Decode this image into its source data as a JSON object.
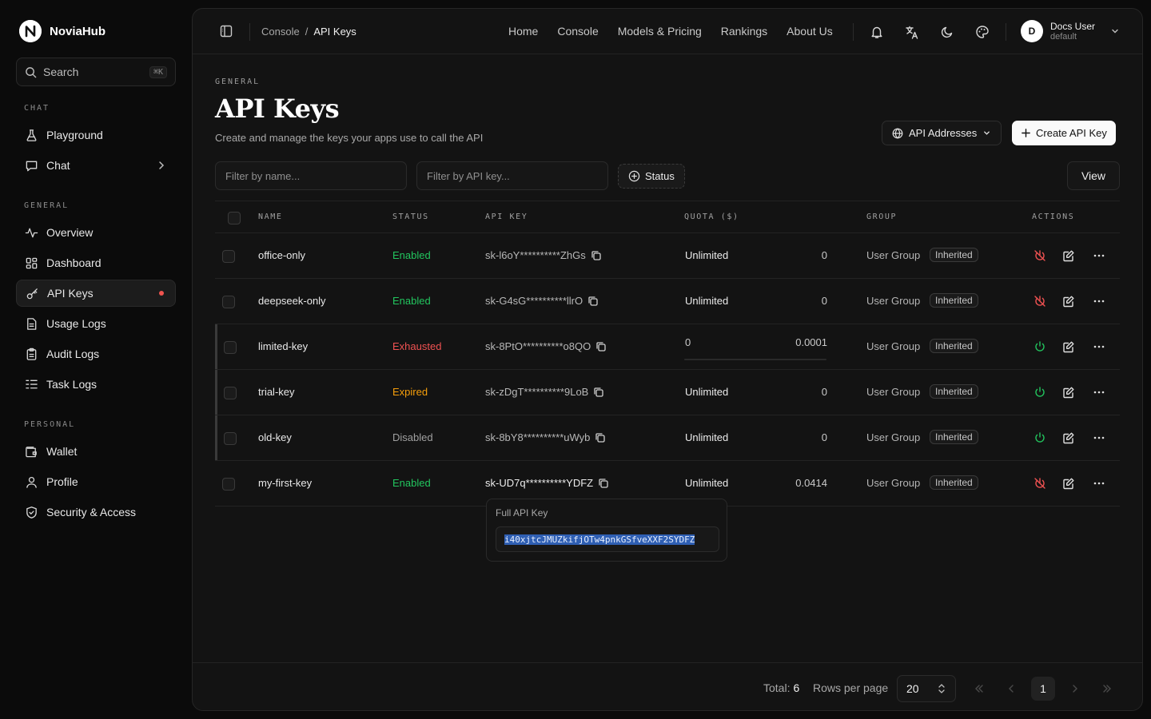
{
  "brand": {
    "name": "NoviaHub"
  },
  "search": {
    "placeholder": "Search",
    "shortcut": "⌘K"
  },
  "sidebar": {
    "sections": [
      {
        "label": "CHAT"
      },
      {
        "label": "GENERAL"
      },
      {
        "label": "PERSONAL"
      }
    ],
    "items": [
      {
        "label": "Playground",
        "icon": "flask-icon"
      },
      {
        "label": "Chat",
        "icon": "message-icon"
      },
      {
        "label": "Overview",
        "icon": "activity-icon"
      },
      {
        "label": "Dashboard",
        "icon": "grid-icon"
      },
      {
        "label": "API Keys",
        "icon": "key-icon",
        "active": true
      },
      {
        "label": "Usage Logs",
        "icon": "file-icon"
      },
      {
        "label": "Audit Logs",
        "icon": "clipboard-icon"
      },
      {
        "label": "Task Logs",
        "icon": "list-icon"
      },
      {
        "label": "Wallet",
        "icon": "wallet-icon"
      },
      {
        "label": "Profile",
        "icon": "user-icon"
      },
      {
        "label": "Security & Access",
        "icon": "shield-icon"
      }
    ]
  },
  "breadcrumb": {
    "parent": "Console",
    "sep": "/",
    "current": "API Keys"
  },
  "topnav": [
    "Home",
    "Console",
    "Models & Pricing",
    "Rankings",
    "About Us"
  ],
  "user": {
    "initial": "D",
    "name": "Docs User",
    "group": "default"
  },
  "page": {
    "eyebrow": "GENERAL",
    "title": "API Keys",
    "subtitle": "Create and manage the keys your apps use to call the API",
    "api_addresses_label": "API Addresses",
    "create_label": "Create API Key"
  },
  "filters": {
    "name_placeholder": "Filter by name...",
    "key_placeholder": "Filter by API key...",
    "status_label": "Status",
    "view_label": "View"
  },
  "table": {
    "headers": [
      "NAME",
      "STATUS",
      "API KEY",
      "QUOTA ($)",
      "GROUP",
      "ACTIONS"
    ],
    "rows": [
      {
        "name": "office-only",
        "status": "Enabled",
        "key": "sk-l6oY**********ZhGs",
        "quota": "Unlimited",
        "used": "0",
        "group": "User Group",
        "badge": "Inherited"
      },
      {
        "name": "deepseek-only",
        "status": "Enabled",
        "key": "sk-G4sG**********llrO",
        "quota": "Unlimited",
        "used": "0",
        "group": "User Group",
        "badge": "Inherited"
      },
      {
        "name": "limited-key",
        "status": "Exhausted",
        "key": "sk-8PtO**********o8QO",
        "quota": "0",
        "used": "0.0001",
        "group": "User Group",
        "badge": "Inherited"
      },
      {
        "name": "trial-key",
        "status": "Expired",
        "key": "sk-zDgT**********9LoB",
        "quota": "Unlimited",
        "used": "0",
        "group": "User Group",
        "badge": "Inherited"
      },
      {
        "name": "old-key",
        "status": "Disabled",
        "key": "sk-8bY8**********uWyb",
        "quota": "Unlimited",
        "used": "0",
        "group": "User Group",
        "badge": "Inherited"
      },
      {
        "name": "my-first-key",
        "status": "Enabled",
        "key": "sk-UD7q**********YDFZ",
        "quota": "Unlimited",
        "used": "0.0414",
        "group": "User Group",
        "badge": "Inherited"
      }
    ]
  },
  "popover": {
    "label": "Full API Key",
    "value": "i40xjtcJMUZkifjOTw4pnkGSfveXXF2SYDFZ"
  },
  "footer": {
    "total_label": "Total:",
    "total": "6",
    "rows_label": "Rows per page",
    "rows_value": "20",
    "page": "1"
  },
  "colors": {
    "enabled": "#22c55e",
    "exhausted": "#f05252",
    "expired": "#f59e0b",
    "disabled": "#a0a0a0",
    "accent": "#fafafa"
  }
}
